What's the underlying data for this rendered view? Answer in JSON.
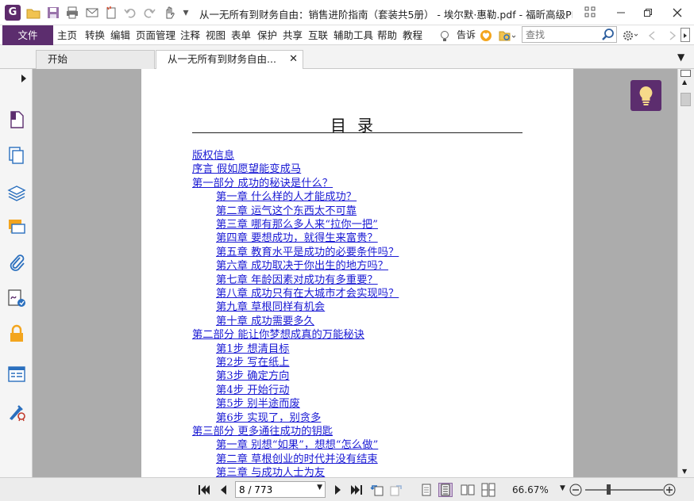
{
  "window": {
    "title": "从一无所有到财务自由：销售进阶指南（套装共5册） - 埃尔默·惠勒.pdf - 福昕高级PD..."
  },
  "app": {
    "logo_letter": "G",
    "accent": "#5c2d6e"
  },
  "menu": {
    "file_label": "文件",
    "items": [
      "主页",
      "转换",
      "编辑",
      "页面管理",
      "注释",
      "视图",
      "表单",
      "保护",
      "共享",
      "互联",
      "辅助工具",
      "帮助",
      "教程"
    ],
    "tell_me": "告诉",
    "search_placeholder": "查找"
  },
  "tabs": [
    {
      "label": "开始"
    },
    {
      "label": "从一无所有到财务自由..."
    }
  ],
  "sidebar": {
    "icons": [
      "page-thumbnail-icon",
      "pages-icon",
      "layers-icon",
      "comments-icon",
      "attachments-icon",
      "signature-icon",
      "security-icon",
      "form-fields-icon",
      "certificate-icon"
    ]
  },
  "document": {
    "toc_title": "目录",
    "entries": [
      {
        "text": "版权信息",
        "level": 0
      },
      {
        "text": "序言 假如愿望能变成马",
        "level": 0
      },
      {
        "text": "第一部分 成功的秘诀是什么？",
        "level": 0
      },
      {
        "text": "第一章 什么样的人才能成功？",
        "level": 1
      },
      {
        "text": "第二章 运气这个东西太不可靠",
        "level": 1
      },
      {
        "text": "第三章 哪有那么多人来“拉你一把”",
        "level": 1
      },
      {
        "text": "第四章 要想成功，就得生来富贵？",
        "level": 1
      },
      {
        "text": "第五章 教育水平是成功的必要条件吗？",
        "level": 1
      },
      {
        "text": "第六章 成功取决于你出生的地方吗？",
        "level": 1
      },
      {
        "text": "第七章 年龄因素对成功有多重要？",
        "level": 1
      },
      {
        "text": "第八章 成功只有在大城市才会实现吗？",
        "level": 1
      },
      {
        "text": "第九章 草根同样有机会",
        "level": 1
      },
      {
        "text": "第十章 成功需要多久",
        "level": 1
      },
      {
        "text": "第二部分 能让你梦想成真的万能秘诀",
        "level": 0
      },
      {
        "text": "第1步 想清目标",
        "level": 1
      },
      {
        "text": "第2步 写在纸上",
        "level": 1
      },
      {
        "text": "第3步 确定方向",
        "level": 1
      },
      {
        "text": "第4步 开始行动",
        "level": 1
      },
      {
        "text": "第5步 别半途而废",
        "level": 1
      },
      {
        "text": "第6步 实现了，别贪多",
        "level": 1
      },
      {
        "text": "第三部分 更多通往成功的钥匙",
        "level": 0
      },
      {
        "text": "第一章 别想“如果”，想想“怎么做”",
        "level": 1
      },
      {
        "text": "第二章 草根创业的时代并没有结束",
        "level": 1
      },
      {
        "text": "第三章 与成功人士为友",
        "level": 1
      }
    ]
  },
  "status": {
    "page_value": "8 / 773",
    "zoom": "66.67%",
    "zoom_fraction": 0.3
  }
}
